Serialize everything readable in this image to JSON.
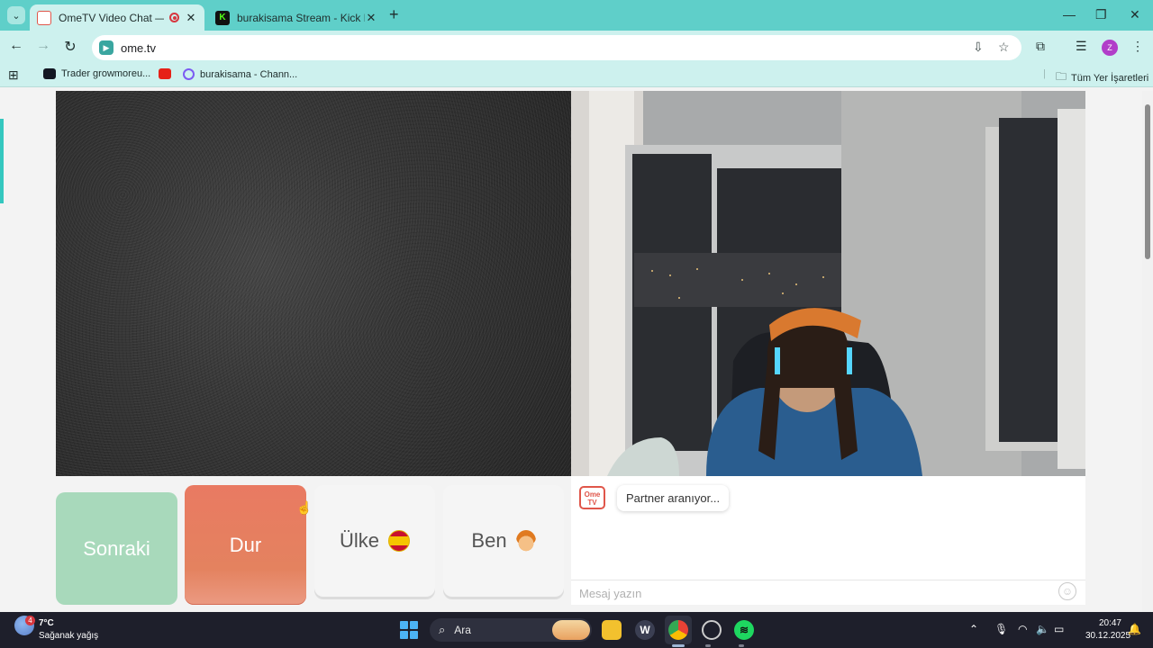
{
  "browser": {
    "tabs": [
      {
        "title": "OmeTV Video Chat — Ome",
        "active": true
      },
      {
        "title": "burakisama Stream - Kick Dash",
        "active": false
      }
    ],
    "url": "ome.tv",
    "profile_initial": "Z",
    "bookmarks": [
      {
        "label": "Trader growmoreu..."
      },
      {
        "label": ""
      },
      {
        "label": "burakisama - Chann..."
      }
    ],
    "all_bookmarks_label": "Tüm Yer İşaretleri"
  },
  "page": {
    "controls": {
      "next_label": "Sonraki",
      "stop_label": "Dur",
      "country_label": "Ülke",
      "me_label": "Ben"
    },
    "chat": {
      "logo_text_top": "Ome",
      "logo_text_bottom": "TV",
      "status_message": "Partner aranıyor...",
      "input_placeholder": "Mesaj yazın"
    }
  },
  "taskbar": {
    "weather_temp": "7°C",
    "weather_desc": "Sağanak yağış",
    "weather_badge": "4",
    "search_label": "Ara",
    "time": "20:47",
    "date": "30.12.2025"
  },
  "colors": {
    "browser_frame": "#5fcfc9",
    "toolbar": "#cdf1ee",
    "next_button": "#a8d9bb",
    "stop_button": "#e97a62",
    "ome_brand": "#e0564a"
  }
}
